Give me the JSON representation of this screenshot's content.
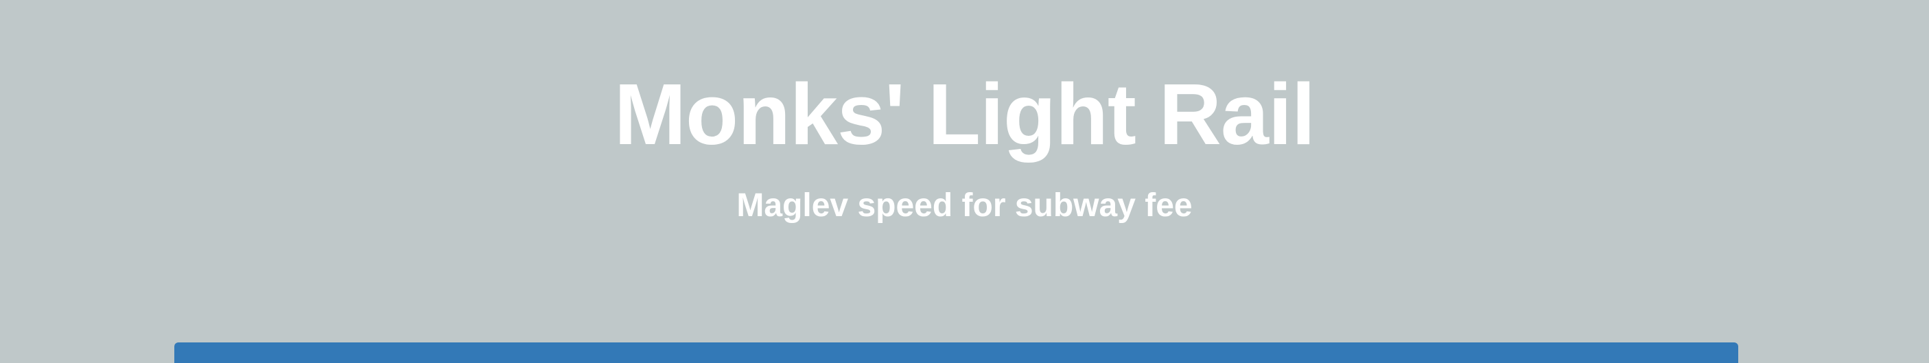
{
  "hero": {
    "title": "Monks' Light Rail",
    "subtitle": "Maglev speed for subway fee"
  },
  "colors": {
    "background": "#bfc8c9",
    "text": "#ffffff",
    "accent_bar": "#3379b7"
  }
}
